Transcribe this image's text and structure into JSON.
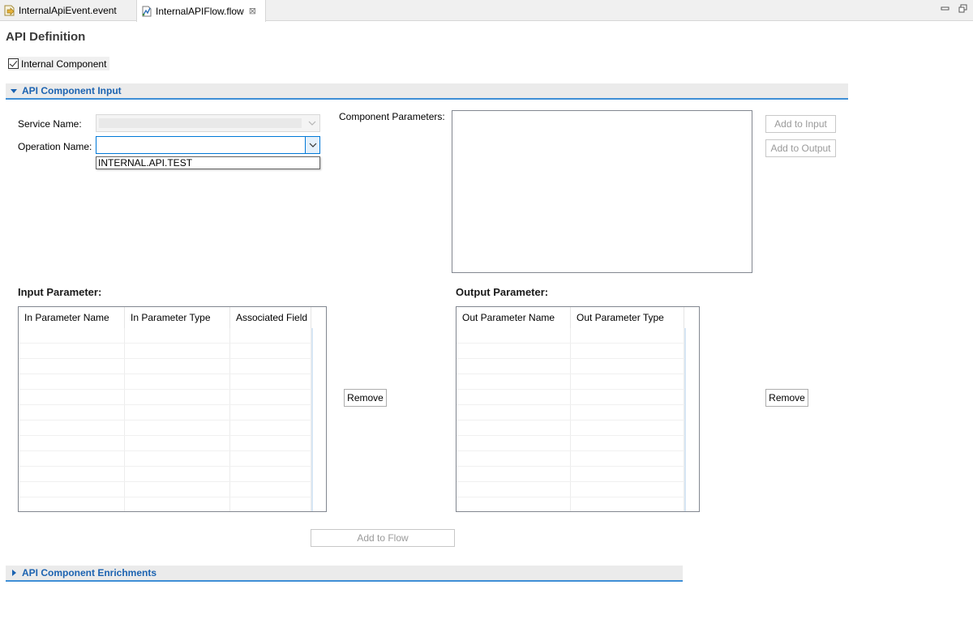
{
  "tabs": [
    {
      "label": "InternalApiEvent.event",
      "icon": "event-file-icon",
      "active": false
    },
    {
      "label": "InternalAPIFlow.flow",
      "icon": "flow-file-icon",
      "active": true,
      "close": "⊠"
    }
  ],
  "page_title": "API Definition",
  "internal_component": {
    "label": "Internal Component",
    "checked": true
  },
  "section_input": {
    "title": "API Component Input",
    "service_name_label": "Service Name:",
    "operation_name_label": "Operation Name:",
    "operation_options": [
      "INTERNAL.API.TEST"
    ],
    "component_parameters_label": "Component Parameters:",
    "add_to_input": "Add to Input",
    "add_to_output": "Add to Output"
  },
  "input_parameter": {
    "title": "Input Parameter:",
    "columns": [
      "In Parameter Name",
      "In Parameter Type",
      "Associated Field"
    ],
    "remove": "Remove"
  },
  "output_parameter": {
    "title": "Output Parameter:",
    "columns": [
      "Out Parameter Name",
      "Out Parameter Type"
    ],
    "remove": "Remove"
  },
  "add_to_flow": "Add to Flow",
  "section_enrichments": {
    "title": "API Component Enrichments"
  },
  "colors": {
    "accent": "#1c63b1",
    "section_underline": "#3f8fd6",
    "focus": "#0078d7"
  }
}
